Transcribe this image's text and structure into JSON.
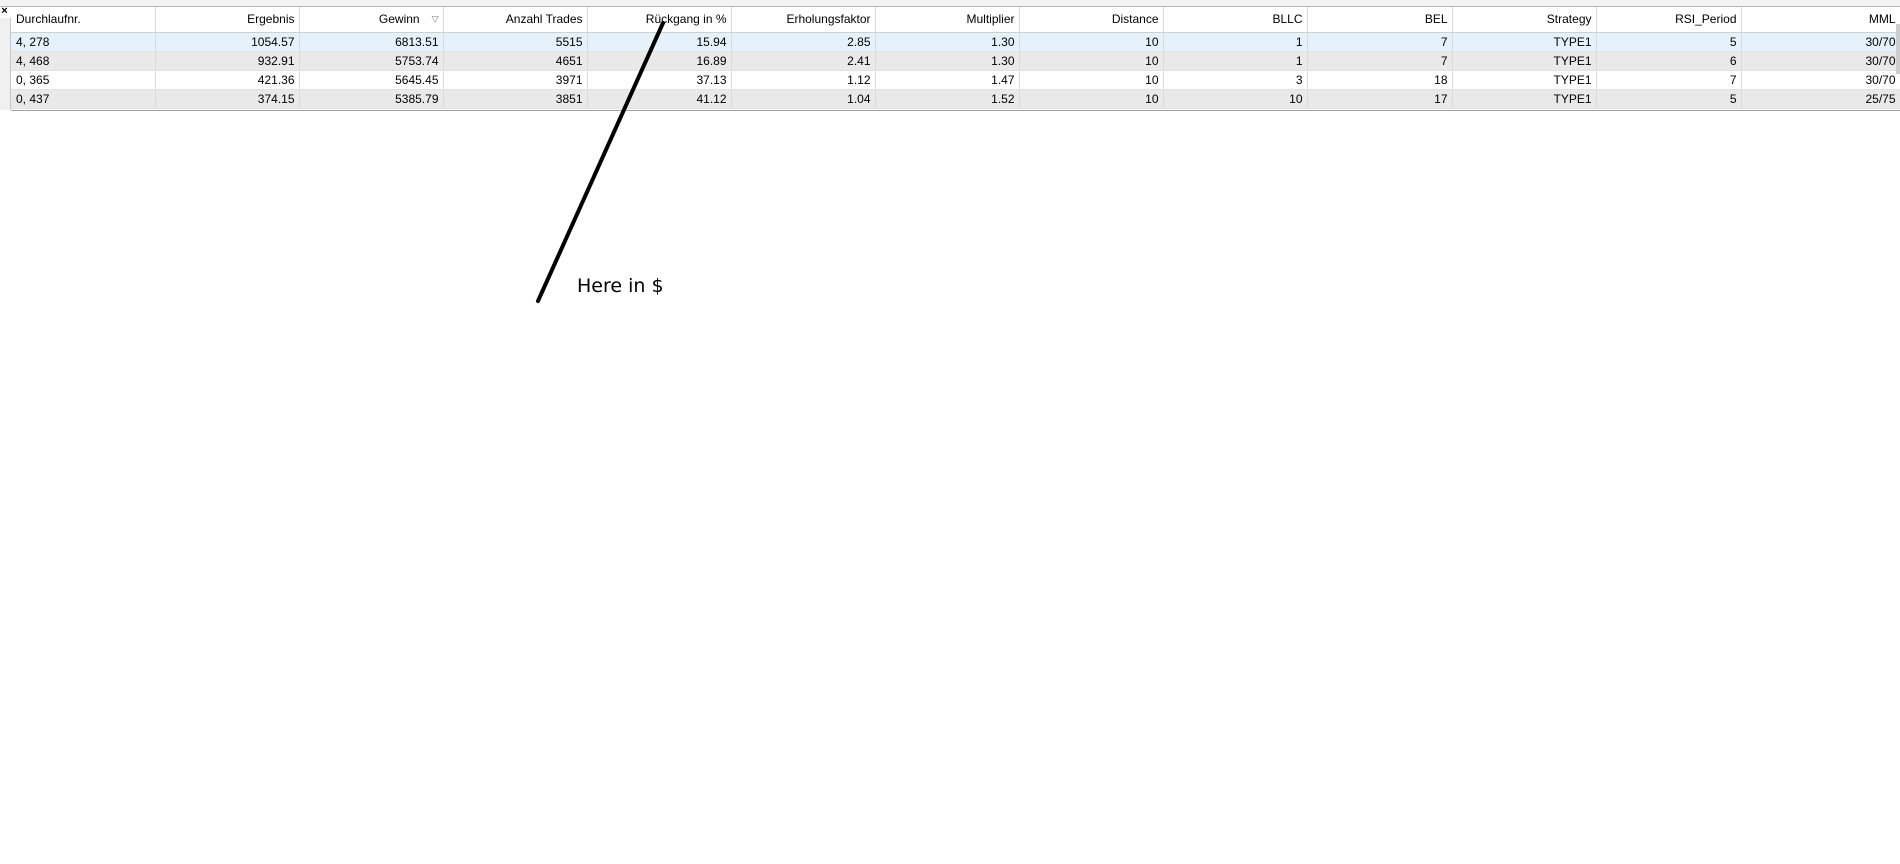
{
  "window": {
    "close_glyph": "×"
  },
  "table": {
    "columns": [
      {
        "key": "run",
        "label": "Durchlaufnr."
      },
      {
        "key": "ergebnis",
        "label": "Ergebnis"
      },
      {
        "key": "gewinn",
        "label": "Gewinn",
        "sorted": true,
        "sort_glyph": "▽"
      },
      {
        "key": "trades",
        "label": "Anzahl Trades"
      },
      {
        "key": "rueckgang",
        "label": "Rückgang in %"
      },
      {
        "key": "erholung",
        "label": "Erholungsfaktor"
      },
      {
        "key": "multiplier",
        "label": "Multiplier"
      },
      {
        "key": "distance",
        "label": "Distance"
      },
      {
        "key": "bllc",
        "label": "BLLC"
      },
      {
        "key": "bel",
        "label": "BEL"
      },
      {
        "key": "strategy",
        "label": "Strategy"
      },
      {
        "key": "rsi",
        "label": "RSI_Period"
      },
      {
        "key": "mml",
        "label": "MML"
      }
    ],
    "rows": [
      [
        "4, 278",
        "1054.57",
        "6813.51",
        "5515",
        "15.94",
        "2.85",
        "1.30",
        "10",
        "1",
        "7",
        "TYPE1",
        "5",
        "30/70"
      ],
      [
        "4, 468",
        "932.91",
        "5753.74",
        "4651",
        "16.89",
        "2.41",
        "1.30",
        "10",
        "1",
        "7",
        "TYPE1",
        "6",
        "30/70"
      ],
      [
        "0, 365",
        "421.36",
        "5645.45",
        "3971",
        "37.13",
        "1.12",
        "1.47",
        "10",
        "3",
        "18",
        "TYPE1",
        "7",
        "30/70"
      ],
      [
        "0, 437",
        "374.15",
        "5385.79",
        "3851",
        "41.12",
        "1.04",
        "1.52",
        "10",
        "10",
        "17",
        "TYPE1",
        "5",
        "25/75"
      ]
    ],
    "selected_row": 0
  },
  "annotation": {
    "text": "Here in $",
    "color": "#000000"
  }
}
